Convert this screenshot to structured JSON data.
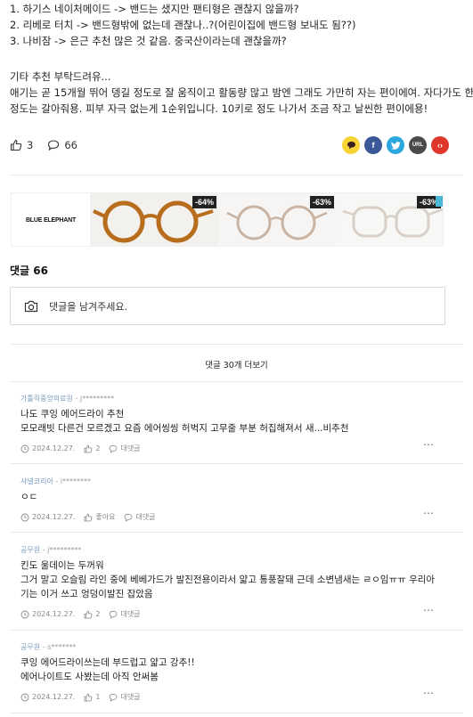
{
  "post": {
    "lines": [
      "1. 하기스 네이처메이드 -> 밴드는 샜지만 팬티형은 괜찮지 않을까?",
      "2. 리베로 터치 -> 밴드형밖에 없는데 괜찮나..?(어린이집에 밴드형 보내도 됨??)",
      "3. 나비잠 -> 은근 추천 많은 것 같음. 중국산이라는데 괜찮을까?",
      "기타 추천 부탁드려유...",
      "애기는 곧 15개월 뛰어 뎅길 정도로 잘 움직이고 활동량 많고 밤엔 그래도 가만히 자는 편이에여. 자다가도 한 번",
      "정도는 갈아줘용. 피부 자극 없는게 1순위입니다. 10키로 정도 나가서 조금 작고 날씬한 편이에용!"
    ],
    "likes": "3",
    "comments": "66"
  },
  "share": {
    "buttons": [
      {
        "name": "kakaotalk",
        "label": "",
        "color": "#f7d335"
      },
      {
        "name": "facebook",
        "label": "f",
        "color": "#3b5998"
      },
      {
        "name": "twitter",
        "label": "",
        "color": "#2ca7e0"
      },
      {
        "name": "url",
        "label": "URL",
        "color": "#4a4a4a"
      },
      {
        "name": "embed",
        "label": "‹›",
        "color": "#e0372d"
      }
    ]
  },
  "ad": {
    "brand": "BLUE ELEPHANT",
    "items": [
      {
        "discount": "-64%",
        "frame": "#b86d1c"
      },
      {
        "discount": "-63%",
        "frame": "#c9b3a3"
      },
      {
        "discount": "-63%",
        "frame": "#d8d0c6"
      }
    ]
  },
  "comment_section": {
    "title": "댓글 66",
    "placeholder": "댓글을 남겨주세요.",
    "more_label": "댓글 30개 더보기"
  },
  "comments": [
    {
      "author": "가톨릭중앙의료원",
      "id": " - j*********",
      "lines": [
        "나도 쿠잉 에어드라이 추천",
        "모모래빗 다른건 모르겠고 요즘 에어씽씽 허벅지 고무줄 부분 허집해져서 새...비추천"
      ],
      "date": "2024.12.27.",
      "likes": "2",
      "reply": "대댓글"
    },
    {
      "author": "샤넬코리아",
      "id": " - i********",
      "lines": [
        "ㅇㄷ"
      ],
      "date": "2024.12.27.",
      "likes": "좋아요",
      "reply": "대댓글"
    },
    {
      "author": "공무원",
      "id": " - j*********",
      "lines": [
        "킨도 울데이는 두꺼워",
        "그거 말고 오슬림 라인 중에 베베가드가 발진전용이라서 얇고 통풍잘돼 근데 소변냄새는 ㄹㅇ임ㅠㅠ 우리아",
        "기는 이거 쓰고 엉덩이발진 잡았음"
      ],
      "date": "2024.12.27.",
      "likes": "2",
      "reply": "대댓글"
    },
    {
      "author": "공무원",
      "id": " - s*******",
      "lines": [
        "쿠잉 에어드라이쓰는데 부드럽고 얇고 강추!!",
        "에어나이트도 사봤는데 아직 안써봄"
      ],
      "date": "2024.12.27.",
      "likes": "1",
      "reply": "대댓글"
    }
  ]
}
